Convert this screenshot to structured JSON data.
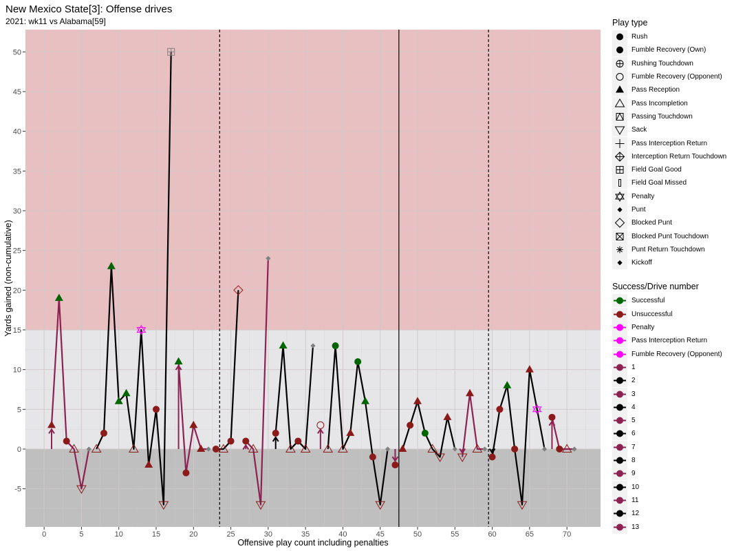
{
  "title": "New Mexico State[3]: Offense drives",
  "subtitle": "2021: wk11 vs Alabama[59]",
  "chart_data": {
    "type": "line",
    "xlabel": "Offensive play count including penalties",
    "ylabel": "Yards gained (non-cumulative)",
    "xlim": [
      -2.5,
      74.5
    ],
    "ylim": [
      -9.8,
      52.8
    ],
    "x_ticks": [
      0,
      5,
      10,
      15,
      20,
      25,
      30,
      35,
      40,
      45,
      50,
      55,
      60,
      65,
      70
    ],
    "y_ticks": [
      -5,
      0,
      5,
      10,
      15,
      20,
      25,
      30,
      35,
      40,
      45,
      50
    ],
    "bands": [
      {
        "from": 15,
        "to": 52.8,
        "color": "#e9c0c2"
      },
      {
        "from": 0,
        "to": 15,
        "color": "#e6e6e8"
      },
      {
        "from": -9.8,
        "to": 0,
        "color": "#bfbfbf"
      }
    ],
    "quarter_lines": [
      {
        "x": 23.5,
        "style": "dashed"
      },
      {
        "x": 47.5,
        "style": "solid"
      },
      {
        "x": 59.5,
        "style": "dashed"
      }
    ],
    "colors": {
      "Successful": "#006400",
      "Unsuccessful": "#8b1a1a",
      "Penalty": "#ff00ff",
      "Other": "#808080"
    },
    "drive_colors": {
      "odd": "#8b2252",
      "even": "#000000"
    },
    "points": [
      {
        "x": 1,
        "y": 3,
        "type": "Pass Reception",
        "result": "Unsuccessful",
        "drive": 1
      },
      {
        "x": 2,
        "y": 19,
        "type": "Pass Reception",
        "result": "Successful",
        "drive": 1
      },
      {
        "x": 3,
        "y": 1,
        "type": "Rush",
        "result": "Unsuccessful",
        "drive": 1
      },
      {
        "x": 4,
        "y": 0,
        "type": "Pass Incompletion",
        "result": "Unsuccessful",
        "drive": 1
      },
      {
        "x": 5,
        "y": -5,
        "type": "Sack",
        "result": "Unsuccessful",
        "drive": 1
      },
      {
        "x": 6,
        "y": 0,
        "type": "Punt",
        "result": "Other",
        "drive": 1
      },
      {
        "x": 7,
        "y": 0,
        "type": "Pass Incompletion",
        "result": "Unsuccessful",
        "drive": 2
      },
      {
        "x": 8,
        "y": 2,
        "type": "Rush",
        "result": "Unsuccessful",
        "drive": 2
      },
      {
        "x": 9,
        "y": 23,
        "type": "Pass Reception",
        "result": "Successful",
        "drive": 2
      },
      {
        "x": 10,
        "y": 6,
        "type": "Pass Reception",
        "result": "Successful",
        "drive": 2
      },
      {
        "x": 11,
        "y": 7,
        "type": "Pass Reception",
        "result": "Successful",
        "drive": 2
      },
      {
        "x": 12,
        "y": 0,
        "type": "Pass Incompletion",
        "result": "Unsuccessful",
        "drive": 2
      },
      {
        "x": 13,
        "y": 15,
        "type": "Penalty",
        "result": "Penalty",
        "drive": 2
      },
      {
        "x": 14,
        "y": -2,
        "type": "Pass Reception",
        "result": "Unsuccessful",
        "drive": 2
      },
      {
        "x": 15,
        "y": 5,
        "type": "Rush",
        "result": "Unsuccessful",
        "drive": 2
      },
      {
        "x": 16,
        "y": -7,
        "type": "Sack",
        "result": "Unsuccessful",
        "drive": 2
      },
      {
        "x": 17,
        "y": 50,
        "type": "Field Goal Good",
        "result": "Other",
        "drive": 2
      },
      {
        "x": 18,
        "y": 11,
        "type": "Pass Reception",
        "result": "Successful",
        "drive": 3
      },
      {
        "x": 19,
        "y": -3,
        "type": "Rush",
        "result": "Unsuccessful",
        "drive": 3
      },
      {
        "x": 20,
        "y": 3,
        "type": "Pass Reception",
        "result": "Unsuccessful",
        "drive": 3
      },
      {
        "x": 21,
        "y": 0,
        "type": "Pass Reception",
        "result": "Unsuccessful",
        "drive": 3
      },
      {
        "x": 22,
        "y": 0,
        "type": "Punt",
        "result": "Other",
        "drive": 3
      },
      {
        "x": 23,
        "y": 0,
        "type": "Rush",
        "result": "Unsuccessful",
        "drive": 4
      },
      {
        "x": 24,
        "y": 0,
        "type": "Pass Incompletion",
        "result": "Unsuccessful",
        "drive": 4
      },
      {
        "x": 25,
        "y": 1,
        "type": "Rush",
        "result": "Unsuccessful",
        "drive": 4
      },
      {
        "x": 26,
        "y": 20,
        "type": "Blocked Punt",
        "result": "Unsuccessful",
        "drive": 4
      },
      {
        "x": 27,
        "y": 1,
        "type": "Rush",
        "result": "Unsuccessful",
        "drive": 5
      },
      {
        "x": 28,
        "y": 0,
        "type": "Pass Incompletion",
        "result": "Unsuccessful",
        "drive": 5
      },
      {
        "x": 29,
        "y": -7,
        "type": "Sack",
        "result": "Unsuccessful",
        "drive": 5
      },
      {
        "x": 30,
        "y": 24,
        "type": "Punt",
        "result": "Other",
        "drive": 5
      },
      {
        "x": 31,
        "y": 2,
        "type": "Rush",
        "result": "Unsuccessful",
        "drive": 6
      },
      {
        "x": 32,
        "y": 13,
        "type": "Pass Reception",
        "result": "Successful",
        "drive": 6
      },
      {
        "x": 33,
        "y": 0,
        "type": "Pass Incompletion",
        "result": "Unsuccessful",
        "drive": 6
      },
      {
        "x": 34,
        "y": 1,
        "type": "Rush",
        "result": "Unsuccessful",
        "drive": 6
      },
      {
        "x": 35,
        "y": 0,
        "type": "Pass Incompletion",
        "result": "Unsuccessful",
        "drive": 6
      },
      {
        "x": 36,
        "y": 13,
        "type": "Punt",
        "result": "Other",
        "drive": 6
      },
      {
        "x": 37,
        "y": 3,
        "type": "Fumble Recovery (Opponent)",
        "result": "Unsuccessful",
        "drive": 7
      },
      {
        "x": 38,
        "y": 0,
        "type": "Pass Incompletion",
        "result": "Unsuccessful",
        "drive": 8
      },
      {
        "x": 39,
        "y": 13,
        "type": "Rush",
        "result": "Successful",
        "drive": 8
      },
      {
        "x": 40,
        "y": 0,
        "type": "Pass Incompletion",
        "result": "Unsuccessful",
        "drive": 8
      },
      {
        "x": 41,
        "y": 2,
        "type": "Pass Reception",
        "result": "Unsuccessful",
        "drive": 8
      },
      {
        "x": 42,
        "y": 11,
        "type": "Rush",
        "result": "Successful",
        "drive": 8
      },
      {
        "x": 43,
        "y": 6,
        "type": "Pass Reception",
        "result": "Successful",
        "drive": 8
      },
      {
        "x": 44,
        "y": -1,
        "type": "Rush",
        "result": "Unsuccessful",
        "drive": 8
      },
      {
        "x": 45,
        "y": -7,
        "type": "Sack",
        "result": "Unsuccessful",
        "drive": 8
      },
      {
        "x": 46,
        "y": 0,
        "type": "Punt",
        "result": "Other",
        "drive": 8
      },
      {
        "x": 47,
        "y": -2,
        "type": "Rush",
        "result": "Unsuccessful",
        "drive": 9
      },
      {
        "x": 48,
        "y": 0,
        "type": "Pass Reception",
        "result": "Unsuccessful",
        "drive": 10
      },
      {
        "x": 49,
        "y": 3,
        "type": "Rush",
        "result": "Unsuccessful",
        "drive": 10
      },
      {
        "x": 50,
        "y": 6,
        "type": "Pass Reception",
        "result": "Unsuccessful",
        "drive": 10
      },
      {
        "x": 51,
        "y": 2,
        "type": "Rush",
        "result": "Successful",
        "drive": 10
      },
      {
        "x": 52,
        "y": 0,
        "type": "Pass Incompletion",
        "result": "Unsuccessful",
        "drive": 10
      },
      {
        "x": 53,
        "y": -1,
        "type": "Sack",
        "result": "Unsuccessful",
        "drive": 10
      },
      {
        "x": 54,
        "y": 4,
        "type": "Pass Reception",
        "result": "Unsuccessful",
        "drive": 10
      },
      {
        "x": 55,
        "y": 0,
        "type": "Punt",
        "result": "Other",
        "drive": 10
      },
      {
        "x": 56,
        "y": -1,
        "type": "Sack",
        "result": "Unsuccessful",
        "drive": 11
      },
      {
        "x": 57,
        "y": 7,
        "type": "Pass Reception",
        "result": "Unsuccessful",
        "drive": 11
      },
      {
        "x": 58,
        "y": 0,
        "type": "Pass Incompletion",
        "result": "Unsuccessful",
        "drive": 11
      },
      {
        "x": 59,
        "y": 0,
        "type": "Punt",
        "result": "Other",
        "drive": 11
      },
      {
        "x": 60,
        "y": -1,
        "type": "Rush",
        "result": "Unsuccessful",
        "drive": 12
      },
      {
        "x": 61,
        "y": 5,
        "type": "Rush",
        "result": "Unsuccessful",
        "drive": 12
      },
      {
        "x": 62,
        "y": 8,
        "type": "Pass Reception",
        "result": "Successful",
        "drive": 12
      },
      {
        "x": 63,
        "y": 0,
        "type": "Rush",
        "result": "Unsuccessful",
        "drive": 12
      },
      {
        "x": 64,
        "y": -7,
        "type": "Sack",
        "result": "Unsuccessful",
        "drive": 12
      },
      {
        "x": 65,
        "y": 10,
        "type": "Pass Reception",
        "result": "Unsuccessful",
        "drive": 12
      },
      {
        "x": 66,
        "y": 5,
        "type": "Penalty",
        "result": "Penalty",
        "drive": 12
      },
      {
        "x": 67,
        "y": 0,
        "type": "Punt",
        "result": "Other",
        "drive": 12
      },
      {
        "x": 68,
        "y": 4,
        "type": "Rush",
        "result": "Unsuccessful",
        "drive": 13
      },
      {
        "x": 69,
        "y": 0,
        "type": "Rush",
        "result": "Unsuccessful",
        "drive": 13
      },
      {
        "x": 70,
        "y": 0,
        "type": "Pass Incompletion",
        "result": "Unsuccessful",
        "drive": 13
      },
      {
        "x": 71,
        "y": 0,
        "type": "Punt",
        "result": "Other",
        "drive": 13
      }
    ]
  },
  "legend": {
    "play_type_title": "Play type",
    "play_types": [
      {
        "label": "Rush",
        "shape": "circle"
      },
      {
        "label": "Fumble Recovery (Own)",
        "shape": "circle"
      },
      {
        "label": "Rushing Touchdown",
        "shape": "circle-plus"
      },
      {
        "label": "Fumble Recovery (Opponent)",
        "shape": "circle-open"
      },
      {
        "label": "Pass Reception",
        "shape": "triangle"
      },
      {
        "label": "Pass Incompletion",
        "shape": "triangle-open"
      },
      {
        "label": "Passing Touchdown",
        "shape": "square-triangle"
      },
      {
        "label": "Sack",
        "shape": "triangle-down-open"
      },
      {
        "label": "Pass Interception Return",
        "shape": "plus"
      },
      {
        "label": "Interception Return Touchdown",
        "shape": "diamond-plus"
      },
      {
        "label": "Field Goal Good",
        "shape": "square-plus"
      },
      {
        "label": "Field Goal Missed",
        "shape": "thin-rect"
      },
      {
        "label": "Penalty",
        "shape": "star-david"
      },
      {
        "label": "Punt",
        "shape": "diamond"
      },
      {
        "label": "Blocked Punt",
        "shape": "diamond-open"
      },
      {
        "label": "Blocked Punt Touchdown",
        "shape": "square-x"
      },
      {
        "label": "Punt Return Touchdown",
        "shape": "asterisk"
      },
      {
        "label": "Kickoff",
        "shape": "diamond"
      }
    ],
    "success_title": "Success/Drive number",
    "success_items": [
      {
        "label": "Successful",
        "color": "#006400"
      },
      {
        "label": "Unsuccessful",
        "color": "#8b1a1a"
      },
      {
        "label": "Penalty",
        "color": "#ff00ff"
      },
      {
        "label": "Pass Interception Return",
        "color": "#ff00ff"
      },
      {
        "label": "Fumble Recovery (Opponent)",
        "color": "#ff00ff"
      },
      {
        "label": "1",
        "color": "#8b2252"
      },
      {
        "label": "2",
        "color": "#000000"
      },
      {
        "label": "3",
        "color": "#8b2252"
      },
      {
        "label": "4",
        "color": "#000000"
      },
      {
        "label": "5",
        "color": "#8b2252"
      },
      {
        "label": "6",
        "color": "#000000"
      },
      {
        "label": "7",
        "color": "#8b2252"
      },
      {
        "label": "8",
        "color": "#000000"
      },
      {
        "label": "9",
        "color": "#8b2252"
      },
      {
        "label": "10",
        "color": "#000000"
      },
      {
        "label": "11",
        "color": "#8b2252"
      },
      {
        "label": "12",
        "color": "#000000"
      },
      {
        "label": "13",
        "color": "#8b2252"
      }
    ]
  }
}
